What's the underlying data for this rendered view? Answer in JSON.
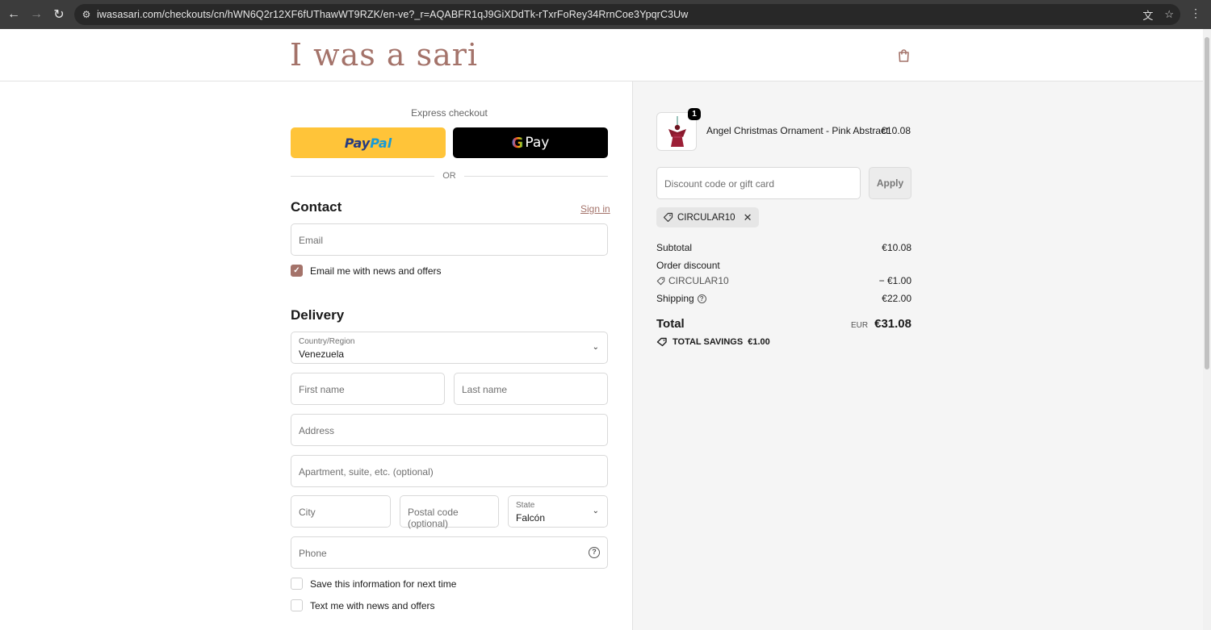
{
  "browser": {
    "url": "iwasasari.com/checkouts/cn/hWN6Q2r12XF6fUThawWT9RZK/en-ve?_r=AQABFR1qJ9GiXDdTk-rTxrFoRey34RrnCoe3YpqrC3Uw"
  },
  "header": {
    "logo": "I was a sari"
  },
  "express": {
    "label": "Express checkout",
    "paypal_part1": "Pay",
    "paypal_part2": "Pal",
    "gpay_g": "G",
    "gpay_label": "Pay",
    "or": "OR"
  },
  "contact": {
    "title": "Contact",
    "sign_in": "Sign in",
    "email_placeholder": "Email",
    "newsletter_label": "Email me with news and offers",
    "newsletter_checked": true
  },
  "delivery": {
    "title": "Delivery",
    "country_label": "Country/Region",
    "country_value": "Venezuela",
    "first_name": "First name",
    "last_name": "Last name",
    "address": "Address",
    "apartment": "Apartment, suite, etc. (optional)",
    "city": "City",
    "postal": "Postal code (optional)",
    "state_label": "State",
    "state_value": "Falcón",
    "phone": "Phone",
    "save_info": "Save this information for next time",
    "text_me": "Text me with news and offers"
  },
  "summary": {
    "item": {
      "quantity": "1",
      "name": "Angel Christmas Ornament - Pink Abstract",
      "price": "€10.08"
    },
    "discount_placeholder": "Discount code or gift card",
    "apply": "Apply",
    "applied_code": "CIRCULAR10",
    "subtotal_label": "Subtotal",
    "subtotal_value": "€10.08",
    "order_discount_label": "Order discount",
    "discount_code": "CIRCULAR10",
    "discount_value": "− €1.00",
    "shipping_label": "Shipping",
    "shipping_value": "€22.00",
    "total_label": "Total",
    "currency": "EUR",
    "total_value": "€31.08",
    "savings_label": "TOTAL SAVINGS",
    "savings_value": "€1.00"
  },
  "colors": {
    "brand": "#a4736a",
    "paypal": "#ffc439"
  }
}
